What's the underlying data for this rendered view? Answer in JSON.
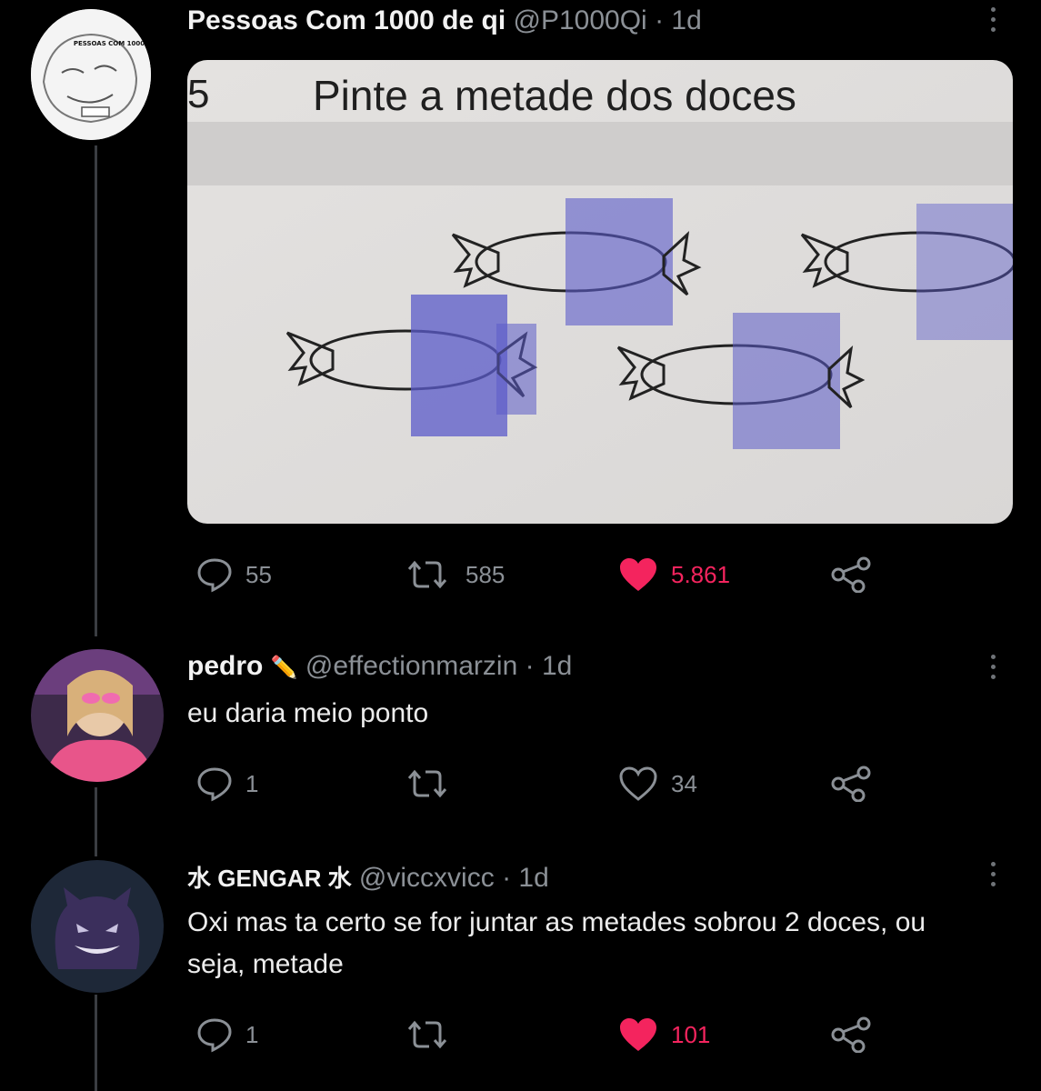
{
  "thread": [
    {
      "author": "Pessoas Com 1000 de qi",
      "handle": "@P1000Qi",
      "separator": "·",
      "time": "1d",
      "avatar_text": "PESSOAS COM 1000 DE QI",
      "media": {
        "title": "Pinte a metade dos doces",
        "exercise_number": "5"
      },
      "actions": {
        "replies": "55",
        "retweets": "585",
        "likes": "5.861",
        "liked": true
      }
    },
    {
      "author": "pedro",
      "author_emoji": "✏️",
      "handle": "@effectionmarzin",
      "separator": "·",
      "time": "1d",
      "text": "eu daria meio ponto",
      "actions": {
        "replies": "1",
        "retweets": "",
        "likes": "34",
        "liked": false
      }
    },
    {
      "author": "水 GENGAR 水",
      "handle": "@viccxvicc",
      "separator": "·",
      "time": "1d",
      "text": "Oxi mas ta certo se for juntar as metades sobrou 2 doces, ou seja, metade",
      "actions": {
        "replies": "1",
        "retweets": "",
        "likes": "101",
        "liked": true
      }
    }
  ],
  "colors": {
    "background": "#000000",
    "like": "#f4245e",
    "muted": "#8b9096",
    "crayon": "#5b5bc9"
  },
  "icons": [
    "reply-icon",
    "retweet-icon",
    "like-icon",
    "share-icon",
    "more-icon"
  ]
}
